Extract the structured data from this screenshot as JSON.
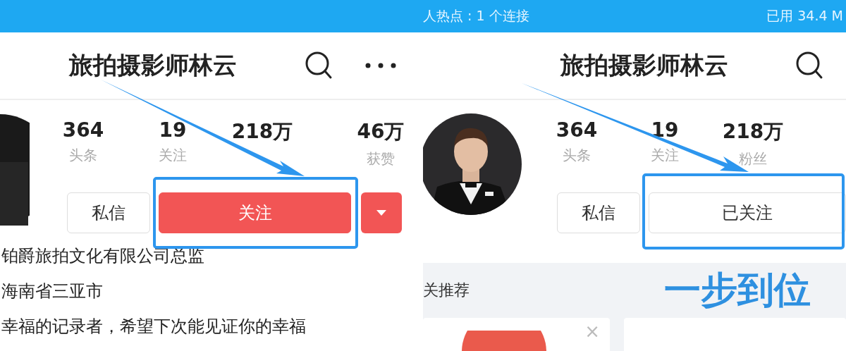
{
  "panels": [
    {
      "title": "旅拍摄影师林云",
      "more_menu": true,
      "stats": [
        {
          "value": "364",
          "label": "头条"
        },
        {
          "value": "19",
          "label": "关注"
        },
        {
          "value": "218万"
        },
        {
          "value": "46万",
          "label": "获赞"
        }
      ],
      "buttons": [
        {
          "kind": "message",
          "label": "私信"
        },
        {
          "kind": "follow",
          "label": "关注",
          "followed": false
        },
        {
          "kind": "dropdown"
        }
      ],
      "bio": [
        "铂爵旅拍文化有限公司总监",
        "海南省三亚市",
        "幸福的记录者，希望下次能见证你的幸福"
      ]
    },
    {
      "status_bar": {
        "left": "人热点 : 1 个连接",
        "right": "已用 34.4 M"
      },
      "title": "旅拍摄影师林云",
      "stats": [
        {
          "value": "364",
          "label": "头条"
        },
        {
          "value": "19",
          "label": "关注"
        },
        {
          "value": "218万",
          "label": "粉丝"
        }
      ],
      "buttons": [
        {
          "kind": "message",
          "label": "私信"
        },
        {
          "kind": "follow",
          "label": "已关注",
          "followed": true
        }
      ],
      "recommend": {
        "title": "关推荐",
        "caption": "一步到位",
        "close": "×"
      }
    }
  ]
}
